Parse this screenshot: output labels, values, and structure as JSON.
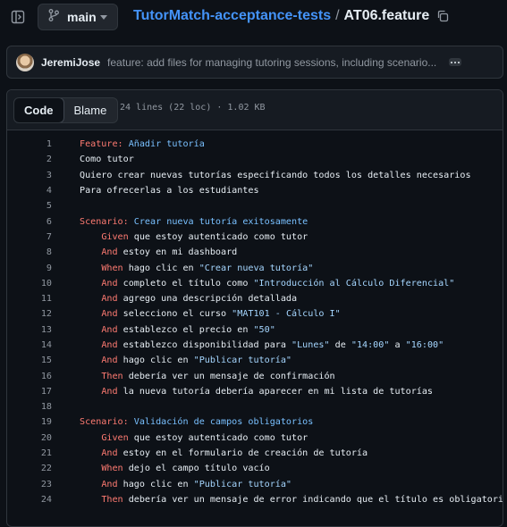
{
  "topbar": {
    "panel_icon": "sidebar-expand-icon",
    "branch": "main",
    "repo": "TutorMatch-acceptance-tests",
    "separator": "/",
    "file": "AT06.feature"
  },
  "commit": {
    "author": "JeremiJose",
    "message": "feature: add files for managing tutoring sessions, including scenario..."
  },
  "code_header": {
    "tab_code": "Code",
    "tab_blame": "Blame",
    "meta": "24 lines (22 loc) · 1.02 KB"
  },
  "colors": {
    "keyword": "#ff7b72",
    "string": "#a5d6ff",
    "title": "#79c0ff",
    "link": "#4493f8"
  },
  "lines": [
    {
      "n": "1",
      "kw": "Feature:",
      "ind": "",
      "text": "",
      "title": " Añadir tutoría"
    },
    {
      "n": "2",
      "kw": "",
      "ind": "",
      "text": "Como tutor"
    },
    {
      "n": "3",
      "kw": "",
      "ind": "",
      "text": "Quiero crear nuevas tutorías especificando todos los detalles necesarios"
    },
    {
      "n": "4",
      "kw": "",
      "ind": "",
      "text": "Para ofrecerlas a los estudiantes"
    },
    {
      "n": "5",
      "kw": "",
      "ind": "",
      "text": ""
    },
    {
      "n": "6",
      "kw": "Scenario:",
      "ind": "",
      "text": "",
      "title": " Crear nueva tutoría exitosamente"
    },
    {
      "n": "7",
      "kw": "Given",
      "ind": "    ",
      "text": " que estoy autenticado como tutor"
    },
    {
      "n": "8",
      "kw": "And",
      "ind": "    ",
      "text": " estoy en mi dashboard"
    },
    {
      "n": "9",
      "kw": "When",
      "ind": "    ",
      "text": " hago clic en ",
      "str": "\"Crear nueva tutoría\""
    },
    {
      "n": "10",
      "kw": "And",
      "ind": "    ",
      "text": " completo el título como ",
      "str": "\"Introducción al Cálculo Diferencial\""
    },
    {
      "n": "11",
      "kw": "And",
      "ind": "    ",
      "text": " agrego una descripción detallada"
    },
    {
      "n": "12",
      "kw": "And",
      "ind": "    ",
      "text": " selecciono el curso ",
      "str": "\"MAT101 - Cálculo I\""
    },
    {
      "n": "13",
      "kw": "And",
      "ind": "    ",
      "text": " establezco el precio en ",
      "str": "\"50\""
    },
    {
      "n": "14",
      "kw": "And",
      "ind": "    ",
      "text": " establezco disponibilidad para ",
      "str": "\"Lunes\"",
      "t2": " de ",
      "s2": "\"14:00\"",
      "t3": " a ",
      "s3": "\"16:00\""
    },
    {
      "n": "15",
      "kw": "And",
      "ind": "    ",
      "text": " hago clic en ",
      "str": "\"Publicar tutoría\""
    },
    {
      "n": "16",
      "kw": "Then",
      "ind": "    ",
      "text": " debería ver un mensaje de confirmación"
    },
    {
      "n": "17",
      "kw": "And",
      "ind": "    ",
      "text": " la nueva tutoría debería aparecer en mi lista de tutorías"
    },
    {
      "n": "18",
      "kw": "",
      "ind": "",
      "text": ""
    },
    {
      "n": "19",
      "kw": "Scenario:",
      "ind": "",
      "text": "",
      "title": " Validación de campos obligatorios"
    },
    {
      "n": "20",
      "kw": "Given",
      "ind": "    ",
      "text": " que estoy autenticado como tutor"
    },
    {
      "n": "21",
      "kw": "And",
      "ind": "    ",
      "text": " estoy en el formulario de creación de tutoría"
    },
    {
      "n": "22",
      "kw": "When",
      "ind": "    ",
      "text": " dejo el campo título vacío"
    },
    {
      "n": "23",
      "kw": "And",
      "ind": "    ",
      "text": " hago clic en ",
      "str": "\"Publicar tutoría\""
    },
    {
      "n": "24",
      "kw": "Then",
      "ind": "    ",
      "text": " debería ver un mensaje de error indicando que el título es obligatorio"
    }
  ]
}
